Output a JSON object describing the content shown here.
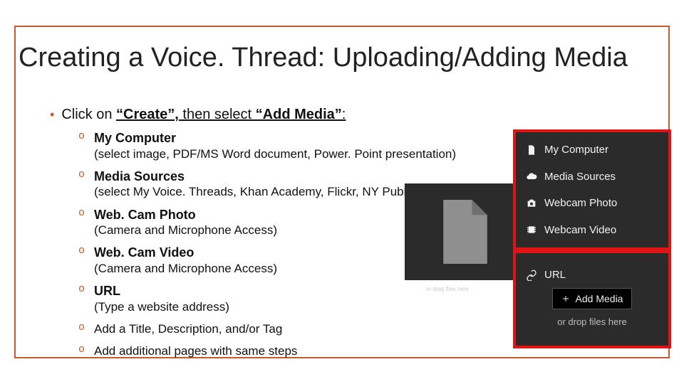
{
  "title": "Creating a Voice. Thread:  Uploading/Adding Media",
  "main_bullet": {
    "pre": "Click on ",
    "b1": "“Create”,",
    "mid": " then select ",
    "b2": "“Add Media”",
    "post": ":"
  },
  "items": [
    {
      "heading": "My Computer",
      "detail": "(select image, PDF/MS Word document, Power. Point presentation)"
    },
    {
      "heading": "Media Sources",
      "detail": "(select My Voice. Threads, Khan Academy, Flickr, NY Public Library)"
    },
    {
      "heading": "Web. Cam Photo",
      "detail": "(Camera and Microphone Access)"
    },
    {
      "heading": "Web. Cam Video",
      "detail": "(Camera and Microphone Access)"
    },
    {
      "heading": "URL",
      "detail": "(Type a website address)"
    },
    {
      "heading": "Add a Title, Description, and/or Tag",
      "detail": ""
    },
    {
      "heading": "Add additional pages with same steps",
      "detail": ""
    }
  ],
  "panel_top": {
    "rows": [
      {
        "icon": "file-icon",
        "label": "My Computer"
      },
      {
        "icon": "cloud-icon",
        "label": "Media Sources"
      },
      {
        "icon": "camera-icon",
        "label": "Webcam Photo"
      },
      {
        "icon": "film-icon",
        "label": "Webcam Video"
      }
    ]
  },
  "panel_bot": {
    "url_label": "URL",
    "add_media": "Add Media",
    "drop_hint": "or drop files here"
  },
  "small_hint": "or drag files here"
}
